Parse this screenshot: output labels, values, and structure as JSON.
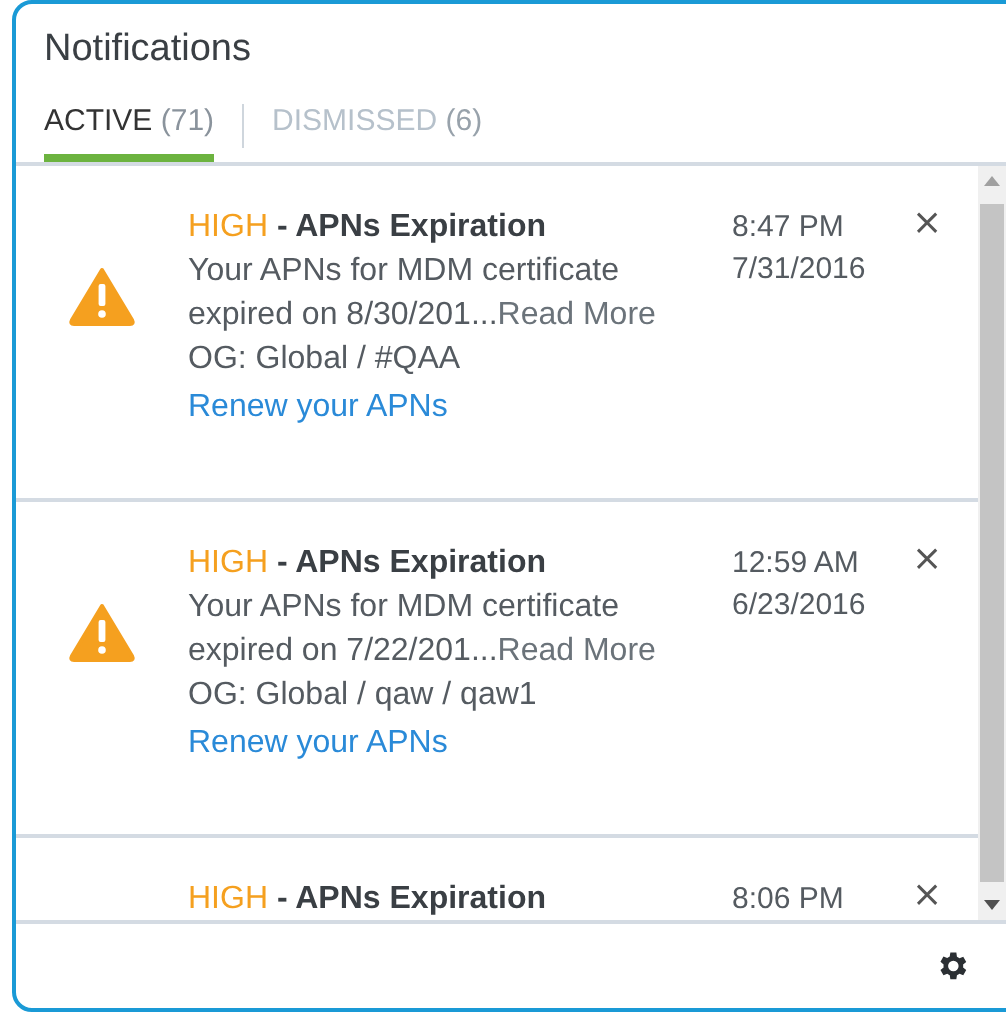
{
  "panel": {
    "title": "Notifications"
  },
  "tabs": [
    {
      "label": "ACTIVE",
      "count": "(71)",
      "selected": true
    },
    {
      "label": "DISMISSED",
      "count": "(6)",
      "selected": false
    }
  ],
  "notifications": [
    {
      "severity": "HIGH",
      "title": "- APNs Expiration",
      "message": "Your APNs for MDM certificate expired on 8/30/201...",
      "read_more": "Read More",
      "og": "OG: Global / #QAA",
      "action": "Renew your APNs",
      "time": "8:47 PM",
      "date": "7/31/2016",
      "close": "×"
    },
    {
      "severity": "HIGH",
      "title": "- APNs Expiration",
      "message": "Your APNs for MDM certificate expired on 7/22/201...",
      "read_more": "Read More",
      "og": "OG: Global / qaw / qaw1",
      "action": "Renew your APNs",
      "time": "12:59 AM",
      "date": "6/23/2016",
      "close": "×"
    },
    {
      "severity": "HIGH",
      "title": "- APNs Expiration",
      "time": "8:06 PM",
      "close": "×"
    }
  ]
}
